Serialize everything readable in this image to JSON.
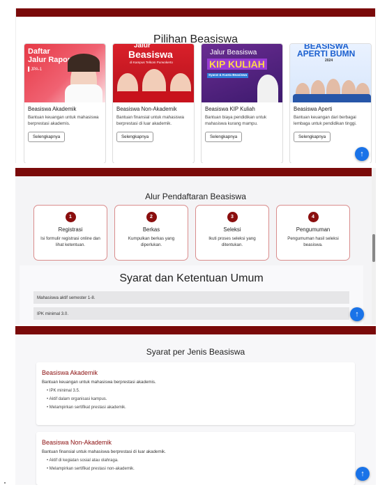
{
  "section_scholarships": {
    "title": "Pilihan Beasiswa",
    "cards": [
      {
        "poster_line1": "Daftar",
        "poster_line2": "Jalur Rapor",
        "poster_line3": "▌JPA-1",
        "title": "Beasiswa Akademik",
        "desc": "Bantuan keuangan untuk mahasiswa berprestasi akademis.",
        "button": "Selengkapnya"
      },
      {
        "poster_line1": "Jalur",
        "poster_line2": "Beasiswa",
        "poster_line3": "di Kampus Telkom Purwokerto",
        "title": "Beasiswa Non-Akademik",
        "desc": "Bantuan finansial untuk mahasiswa berprestasi di luar akademik.",
        "button": "Selengkapnya"
      },
      {
        "poster_line1": "Jalur Beasiswa",
        "poster_line2": "KIP KULIAH",
        "poster_line3": "Syarat & Kuota Beasiswa",
        "title": "Beasiswa KIP Kuliah",
        "desc": "Bantuan biaya pendidikan untuk mahasiswa kurang mampu.",
        "button": "Selengkapnya"
      },
      {
        "poster_line1": "BEASISWA",
        "poster_line2": "APERTI BUMN",
        "poster_line3": "2024",
        "title": "Beasiswa Aperti",
        "desc": "Bantuan keuangan dari berbagai lembaga untuk pendidikan tinggi.",
        "button": "Selengkapnya"
      }
    ]
  },
  "section_flow": {
    "title": "Alur Pendaftaran Beasiswa",
    "steps": [
      {
        "number": "1",
        "name": "Registrasi",
        "desc": "Isi formulir registrasi online dan lihat ketentuan."
      },
      {
        "number": "2",
        "name": "Berkas",
        "desc": "Kumpulkan berkas yang diperlukan."
      },
      {
        "number": "3",
        "name": "Seleksi",
        "desc": "Ikuti proses seleksi yang ditentukan."
      },
      {
        "number": "4",
        "name": "Pengumuman",
        "desc": "Pengumuman hasil seleksi beasiswa."
      }
    ],
    "general_title": "Syarat dan Ketentuan Umum",
    "general_items": [
      "Mahasiswa aktif semester 1-8.",
      "IPK minimal 3.0."
    ]
  },
  "section_requirements": {
    "title": "Syarat per Jenis Beasiswa",
    "groups": [
      {
        "heading": "Beasiswa Akademik",
        "desc": "Bantuan keuangan untuk mahasiswa berprestasi akademis.",
        "items": [
          "IPK minimal 3.5.",
          "Aktif dalam organisasi kampus.",
          "Melampirkan sertifikat prestasi akademik."
        ]
      },
      {
        "heading": "Beasiswa Non-Akademik",
        "desc": "Bantuan finansial untuk mahasiswa berprestasi di luar akademik.",
        "items": [
          "Aktif di kegiatan sosial atau olahraga.",
          "Melampirkan sertifikat prestasi non-akademik."
        ]
      }
    ]
  },
  "fab": {
    "icon": "arrow-up-icon",
    "glyph": "↑"
  },
  "colors": {
    "brand_red": "#7a0a0a",
    "accent_blue": "#1a73e8",
    "heading_red": "#8a0e0e"
  }
}
